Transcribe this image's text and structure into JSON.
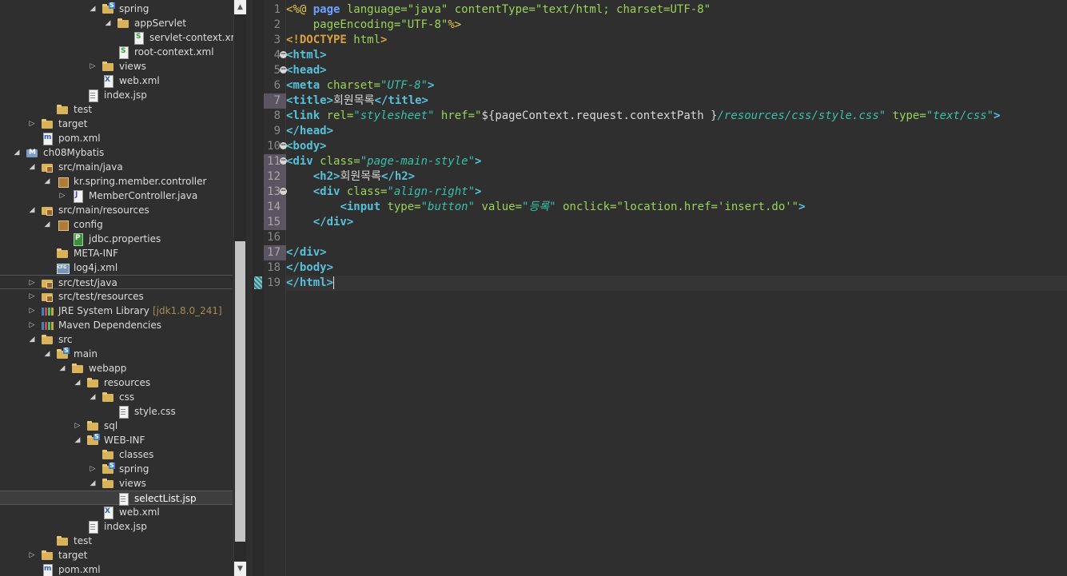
{
  "explorer": {
    "rows": [
      {
        "label": "spring",
        "indent": 5,
        "twisty": "open",
        "icon": "springfolder"
      },
      {
        "label": "appServlet",
        "indent": 6,
        "twisty": "open",
        "icon": "folder"
      },
      {
        "label": "servlet-context.xml",
        "indent": 7,
        "twisty": "",
        "icon": "springxml"
      },
      {
        "label": "root-context.xml",
        "indent": 6,
        "twisty": "",
        "icon": "springxml"
      },
      {
        "label": "views",
        "indent": 5,
        "twisty": "closed",
        "icon": "folder"
      },
      {
        "label": "web.xml",
        "indent": 5,
        "twisty": "",
        "icon": "xml"
      },
      {
        "label": "index.jsp",
        "indent": 4,
        "twisty": "",
        "icon": "file"
      },
      {
        "label": "test",
        "indent": 2,
        "twisty": "",
        "icon": "folder"
      },
      {
        "label": "target",
        "indent": 1,
        "twisty": "closed",
        "icon": "folder"
      },
      {
        "label": "pom.xml",
        "indent": 1,
        "twisty": "",
        "icon": "pom"
      },
      {
        "label": "ch08Mybatis",
        "indent": 0,
        "twisty": "open",
        "icon": "project"
      },
      {
        "label": "src/main/java",
        "indent": 1,
        "twisty": "open",
        "icon": "pkgfolder"
      },
      {
        "label": "kr.spring.member.controller",
        "indent": 2,
        "twisty": "open",
        "icon": "pkg"
      },
      {
        "label": "MemberController.java",
        "indent": 3,
        "twisty": "closed",
        "icon": "java"
      },
      {
        "label": "src/main/resources",
        "indent": 1,
        "twisty": "open",
        "icon": "pkgfolder"
      },
      {
        "label": "config",
        "indent": 2,
        "twisty": "open",
        "icon": "pkg"
      },
      {
        "label": "jdbc.properties",
        "indent": 3,
        "twisty": "",
        "icon": "props"
      },
      {
        "label": "META-INF",
        "indent": 2,
        "twisty": "",
        "icon": "folder"
      },
      {
        "label": "log4j.xml",
        "indent": 2,
        "twisty": "",
        "icon": "cfg"
      },
      {
        "label": "src/test/java",
        "indent": 1,
        "twisty": "closed",
        "icon": "pkgfolder",
        "boxed": true
      },
      {
        "label": "src/test/resources",
        "indent": 1,
        "twisty": "closed",
        "icon": "pkgfolder"
      },
      {
        "label": "JRE System Library",
        "indent": 1,
        "twisty": "closed",
        "icon": "lib",
        "decoration": "[jdk1.8.0_241]"
      },
      {
        "label": "Maven Dependencies",
        "indent": 1,
        "twisty": "closed",
        "icon": "lib"
      },
      {
        "label": "src",
        "indent": 1,
        "twisty": "open",
        "icon": "folder"
      },
      {
        "label": "main",
        "indent": 2,
        "twisty": "open",
        "icon": "springfolder"
      },
      {
        "label": "webapp",
        "indent": 3,
        "twisty": "open",
        "icon": "folder"
      },
      {
        "label": "resources",
        "indent": 4,
        "twisty": "open",
        "icon": "folder"
      },
      {
        "label": "css",
        "indent": 5,
        "twisty": "open",
        "icon": "folder"
      },
      {
        "label": "style.css",
        "indent": 6,
        "twisty": "",
        "icon": "file"
      },
      {
        "label": "sql",
        "indent": 4,
        "twisty": "closed",
        "icon": "folder"
      },
      {
        "label": "WEB-INF",
        "indent": 4,
        "twisty": "open",
        "icon": "springfolder"
      },
      {
        "label": "classes",
        "indent": 5,
        "twisty": "",
        "icon": "folder"
      },
      {
        "label": "spring",
        "indent": 5,
        "twisty": "closed",
        "icon": "springfolder"
      },
      {
        "label": "views",
        "indent": 5,
        "twisty": "open",
        "icon": "folder"
      },
      {
        "label": "selectList.jsp",
        "indent": 6,
        "twisty": "",
        "icon": "file",
        "selected": true
      },
      {
        "label": "web.xml",
        "indent": 5,
        "twisty": "",
        "icon": "xml"
      },
      {
        "label": "index.jsp",
        "indent": 4,
        "twisty": "",
        "icon": "file"
      },
      {
        "label": "test",
        "indent": 2,
        "twisty": "",
        "icon": "folder"
      },
      {
        "label": "target",
        "indent": 1,
        "twisty": "closed",
        "icon": "folder"
      },
      {
        "label": "pom.xml",
        "indent": 1,
        "twisty": "",
        "icon": "pom"
      }
    ]
  },
  "editor": {
    "current_line": 19,
    "highlighted_lines": [
      7,
      11,
      12,
      13,
      14,
      15,
      17
    ],
    "fold_lines": [
      4,
      5,
      10,
      11,
      13
    ],
    "lines": [
      {
        "n": "1",
        "tokens": [
          [
            "dir",
            "<%@ "
          ],
          [
            "kw",
            "page "
          ],
          [
            "jattr",
            "language="
          ],
          [
            "jval",
            "\"java\" "
          ],
          [
            "jattr",
            "contentType="
          ],
          [
            "jval",
            "\"text/html; charset=UTF-8\""
          ]
        ]
      },
      {
        "n": "2",
        "tokens": [
          [
            "jattr",
            "    pageEncoding="
          ],
          [
            "jval",
            "\"UTF-8\""
          ],
          [
            "dir",
            "%>"
          ]
        ]
      },
      {
        "n": "3",
        "tokens": [
          [
            "doc",
            "<!DOCTYPE "
          ],
          [
            "doc2",
            "html"
          ],
          [
            "doc",
            ">"
          ]
        ]
      },
      {
        "n": "4",
        "tokens": [
          [
            "tag",
            "<html>"
          ]
        ]
      },
      {
        "n": "5",
        "tokens": [
          [
            "tag",
            "<head>"
          ]
        ]
      },
      {
        "n": "6",
        "tokens": [
          [
            "tag",
            "<meta "
          ],
          [
            "attr",
            "charset="
          ],
          [
            "val",
            "\"UTF-8\""
          ],
          [
            "tag",
            ">"
          ]
        ]
      },
      {
        "n": "7",
        "tokens": [
          [
            "tag",
            "<title>"
          ],
          [
            "el",
            "회원목록"
          ],
          [
            "tag",
            "</title>"
          ]
        ]
      },
      {
        "n": "8",
        "tokens": [
          [
            "tag",
            "<link "
          ],
          [
            "attr",
            "rel="
          ],
          [
            "val",
            "\"stylesheet\" "
          ],
          [
            "attr",
            "href="
          ],
          [
            "jval",
            "\""
          ],
          [
            "el",
            "${pageContext.request.contextPath }"
          ],
          [
            "val",
            "/resources/css/style.css\" "
          ],
          [
            "attr",
            "type="
          ],
          [
            "val",
            "\"text/css\""
          ],
          [
            "tag",
            ">"
          ]
        ]
      },
      {
        "n": "9",
        "tokens": [
          [
            "tag",
            "</head>"
          ]
        ]
      },
      {
        "n": "10",
        "tokens": [
          [
            "tag",
            "<body>"
          ]
        ]
      },
      {
        "n": "11",
        "tokens": [
          [
            "tag",
            "<div "
          ],
          [
            "attr",
            "class="
          ],
          [
            "val",
            "\"page-main-style\""
          ],
          [
            "tag",
            ">"
          ]
        ]
      },
      {
        "n": "12",
        "tokens": [
          [
            "el",
            "    "
          ],
          [
            "tag",
            "<h2>"
          ],
          [
            "el",
            "회원목록"
          ],
          [
            "tag",
            "</h2>"
          ]
        ]
      },
      {
        "n": "13",
        "tokens": [
          [
            "el",
            "    "
          ],
          [
            "tag",
            "<div "
          ],
          [
            "attr",
            "class="
          ],
          [
            "val",
            "\"align-right\""
          ],
          [
            "tag",
            ">"
          ]
        ]
      },
      {
        "n": "14",
        "tokens": [
          [
            "el",
            "        "
          ],
          [
            "tag",
            "<input "
          ],
          [
            "attr",
            "type="
          ],
          [
            "val",
            "\"button\" "
          ],
          [
            "attr",
            "value="
          ],
          [
            "val",
            "\"등록\" "
          ],
          [
            "attr",
            "onclick="
          ],
          [
            "jval",
            "\"location.href='insert.do'\""
          ],
          [
            "tag",
            ">"
          ]
        ]
      },
      {
        "n": "15",
        "tokens": [
          [
            "el",
            "    "
          ],
          [
            "tag",
            "</div>"
          ]
        ]
      },
      {
        "n": "16",
        "tokens": []
      },
      {
        "n": "17",
        "tokens": [
          [
            "tag",
            "</div>"
          ]
        ]
      },
      {
        "n": "18",
        "tokens": [
          [
            "tag",
            "</body>"
          ]
        ]
      },
      {
        "n": "19",
        "tokens": [
          [
            "tag",
            "</html>"
          ]
        ]
      }
    ]
  },
  "colors": {
    "background": "#2f2f2f",
    "tag": "#58c0d8",
    "attribute": "#9bd35a",
    "value": "#38c0a8",
    "directive": "#e6c84e",
    "keyword": "#70a0ff"
  }
}
